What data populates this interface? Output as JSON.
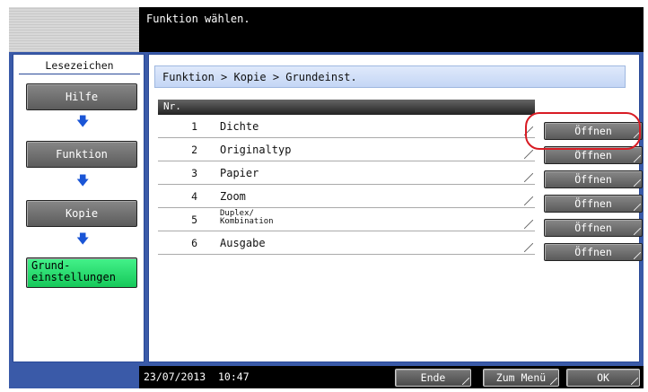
{
  "header": {
    "title": "Funktion wählen."
  },
  "sidebar": {
    "tab_label": "Lesezeichen",
    "items": [
      {
        "label": "Hilfe"
      },
      {
        "label": "Funktion"
      },
      {
        "label": "Kopie"
      },
      {
        "label": "Grund-\neinstellungen"
      }
    ]
  },
  "breadcrumb": "Funktion > Kopie > Grundeinst.",
  "table": {
    "header": "Nr.",
    "rows": [
      {
        "num": "1",
        "label": "Dichte",
        "action": "Öffnen"
      },
      {
        "num": "2",
        "label": "Originaltyp",
        "action": "Öffnen"
      },
      {
        "num": "3",
        "label": "Papier",
        "action": "Öffnen"
      },
      {
        "num": "4",
        "label": "Zoom",
        "action": "Öffnen"
      },
      {
        "num": "5",
        "label": "Duplex/\nKombination",
        "action": "Öffnen"
      },
      {
        "num": "6",
        "label": "Ausgabe",
        "action": "Öffnen"
      }
    ]
  },
  "footer": {
    "date": "23/07/2013",
    "time": "10:47",
    "end_label": "Ende",
    "menu_label": "Zum Menü",
    "ok_label": "OK"
  },
  "colors": {
    "frame_blue": "#3a5aa8",
    "active_green": "#16c85a",
    "highlight_red": "#d81c24",
    "arrow_blue": "#1a55d6"
  },
  "icons": {
    "flow_arrow": "arrow-down-icon"
  }
}
